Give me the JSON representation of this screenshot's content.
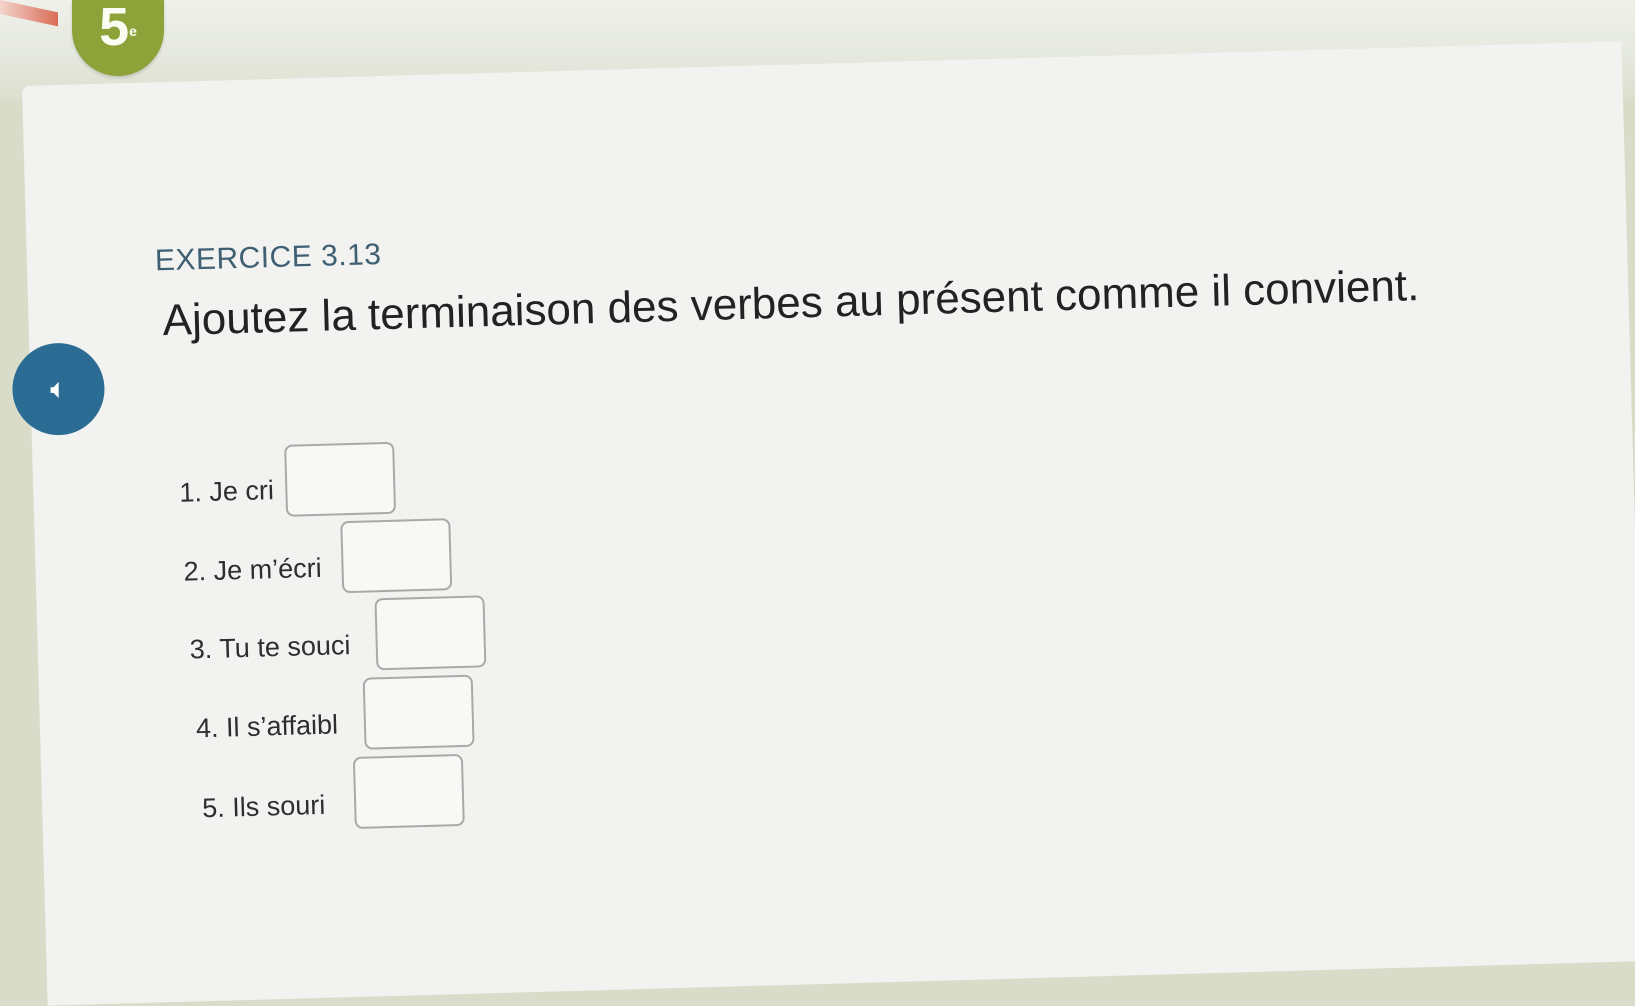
{
  "badge": {
    "number": "5",
    "suffix": "e"
  },
  "exercise": {
    "label": "EXERCICE 3.13"
  },
  "instruction": "Ajoutez la terminaison des verbes au présent comme il convient.",
  "audio": {
    "icon": "speaker-icon"
  },
  "items": [
    {
      "label": "1. Je cri",
      "value": ""
    },
    {
      "label": "2. Je m’écri",
      "value": ""
    },
    {
      "label": "3. Tu te souci",
      "value": ""
    },
    {
      "label": "4. Il s’affaibl",
      "value": ""
    },
    {
      "label": "5. Ils souri",
      "value": ""
    }
  ],
  "colors": {
    "badge": "#8ea23a",
    "exercise_label": "#3f5f73",
    "audio_button": "#2a6c93",
    "card": "#f2f2f0"
  }
}
